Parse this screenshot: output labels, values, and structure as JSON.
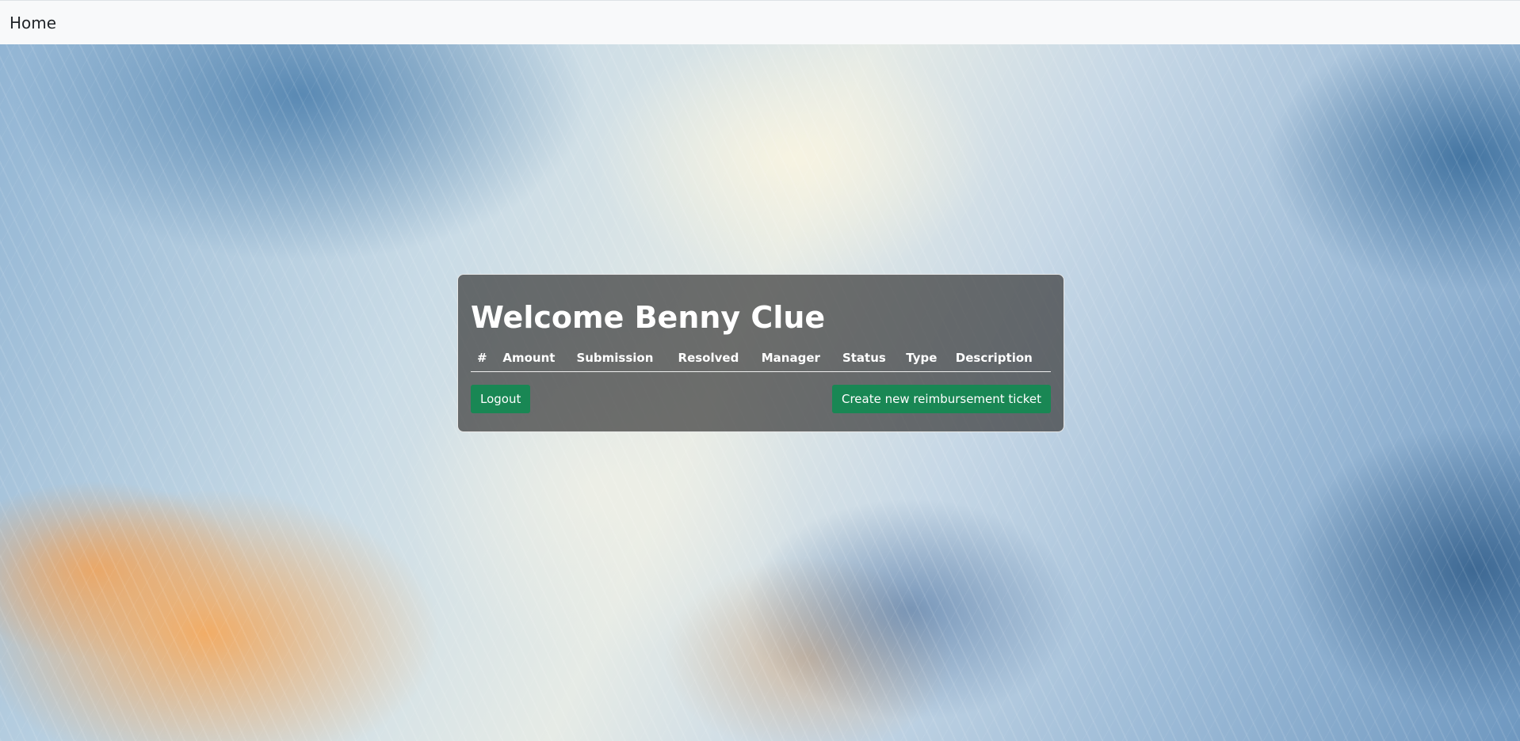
{
  "navbar": {
    "brand": "Home"
  },
  "main": {
    "title": "Welcome Benny Clue",
    "table": {
      "columns": [
        "#",
        "Amount",
        "Submission",
        "Resolved",
        "Manager",
        "Status",
        "Type",
        "Description"
      ],
      "rows": []
    },
    "logout_label": "Logout",
    "create_label": "Create new reimbursement ticket"
  },
  "colors": {
    "button": "#198754",
    "navbar_bg": "#f8f9fa"
  }
}
